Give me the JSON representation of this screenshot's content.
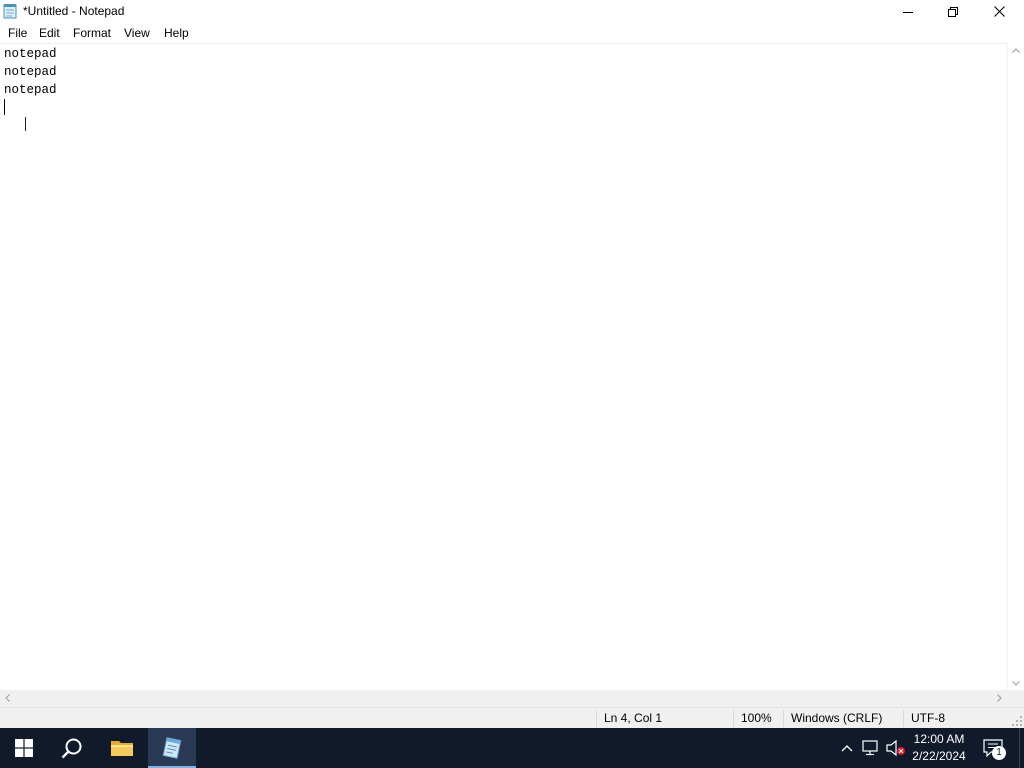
{
  "window": {
    "title": "*Untitled - Notepad"
  },
  "menu": {
    "items": [
      "File",
      "Edit",
      "Format",
      "View",
      "Help"
    ]
  },
  "editor": {
    "lines": [
      "notepad",
      "notepad",
      "notepad",
      ""
    ]
  },
  "status": {
    "position": "Ln 4, Col 1",
    "zoom": "100%",
    "line_ending": "Windows (CRLF)",
    "encoding": "UTF-8"
  },
  "taskbar": {
    "apps": [
      "start-icon",
      "search-icon",
      "file-explorer-icon",
      "notepad-icon"
    ],
    "clock": {
      "time": "12:00 AM",
      "date": "2/22/2024"
    },
    "notification_count": "1"
  },
  "colors": {
    "taskbar_bg": "#101a2a",
    "statusbar_bg": "#f0f0f0",
    "editor_bg": "#ffffff",
    "windows_blue": "#0078d7",
    "folder_yellow": "#f2c04a"
  }
}
